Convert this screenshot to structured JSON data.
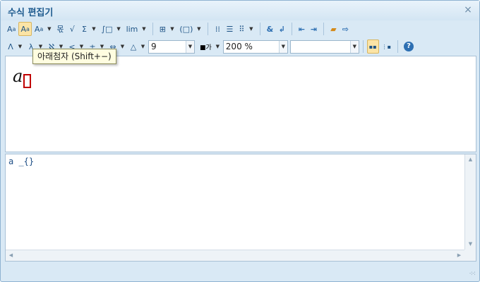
{
  "window": {
    "title": "수식 편집기",
    "close_icon": "×"
  },
  "toolbar1": {
    "buttons": [
      {
        "name": "superscript-button",
        "label": "A",
        "sub": "a"
      },
      {
        "name": "subscript-button",
        "label": "A",
        "sub": "a"
      },
      {
        "name": "above-script-button",
        "label": "A",
        "sub": "a"
      },
      {
        "name": "fraction-button",
        "label": "몫"
      },
      {
        "name": "root-button",
        "label": "√"
      },
      {
        "name": "sum-button",
        "label": "Σ"
      },
      {
        "name": "integral-button",
        "label": "∫□"
      },
      {
        "name": "limit-button",
        "label": "lim"
      },
      {
        "name": "layout-button",
        "label": "⊞"
      },
      {
        "name": "bracket-button",
        "label": "(□)"
      },
      {
        "name": "matrix-button",
        "label": "⁞⁞"
      },
      {
        "name": "align-button",
        "label": "☰"
      },
      {
        "name": "array-button",
        "label": "⠿"
      },
      {
        "name": "ampersand-button",
        "label": "&"
      },
      {
        "name": "newline-button",
        "label": "↲"
      },
      {
        "name": "prev-button",
        "label": "⇤"
      },
      {
        "name": "next-button",
        "label": "⇥"
      },
      {
        "name": "open-button",
        "label": "📂"
      },
      {
        "name": "save-button",
        "label": "⇨"
      }
    ]
  },
  "toolbar2": {
    "buttons": [
      {
        "name": "greek-button",
        "label": "Λ"
      },
      {
        "name": "lambda-button",
        "label": "λ"
      },
      {
        "name": "aleph-button",
        "label": "ℵ"
      },
      {
        "name": "relation-button",
        "label": "<"
      },
      {
        "name": "operator-button",
        "label": "±"
      },
      {
        "name": "arrow-button",
        "label": "⇔"
      },
      {
        "name": "triangle-button",
        "label": "△"
      }
    ],
    "font_size": "9",
    "color_icon": "■가",
    "zoom": "200 %",
    "font_select": ""
  },
  "tooltip": {
    "text": "아래첨자 (Shift+−)"
  },
  "editor": {
    "formula": "a"
  },
  "source": {
    "text": "a _{}"
  }
}
